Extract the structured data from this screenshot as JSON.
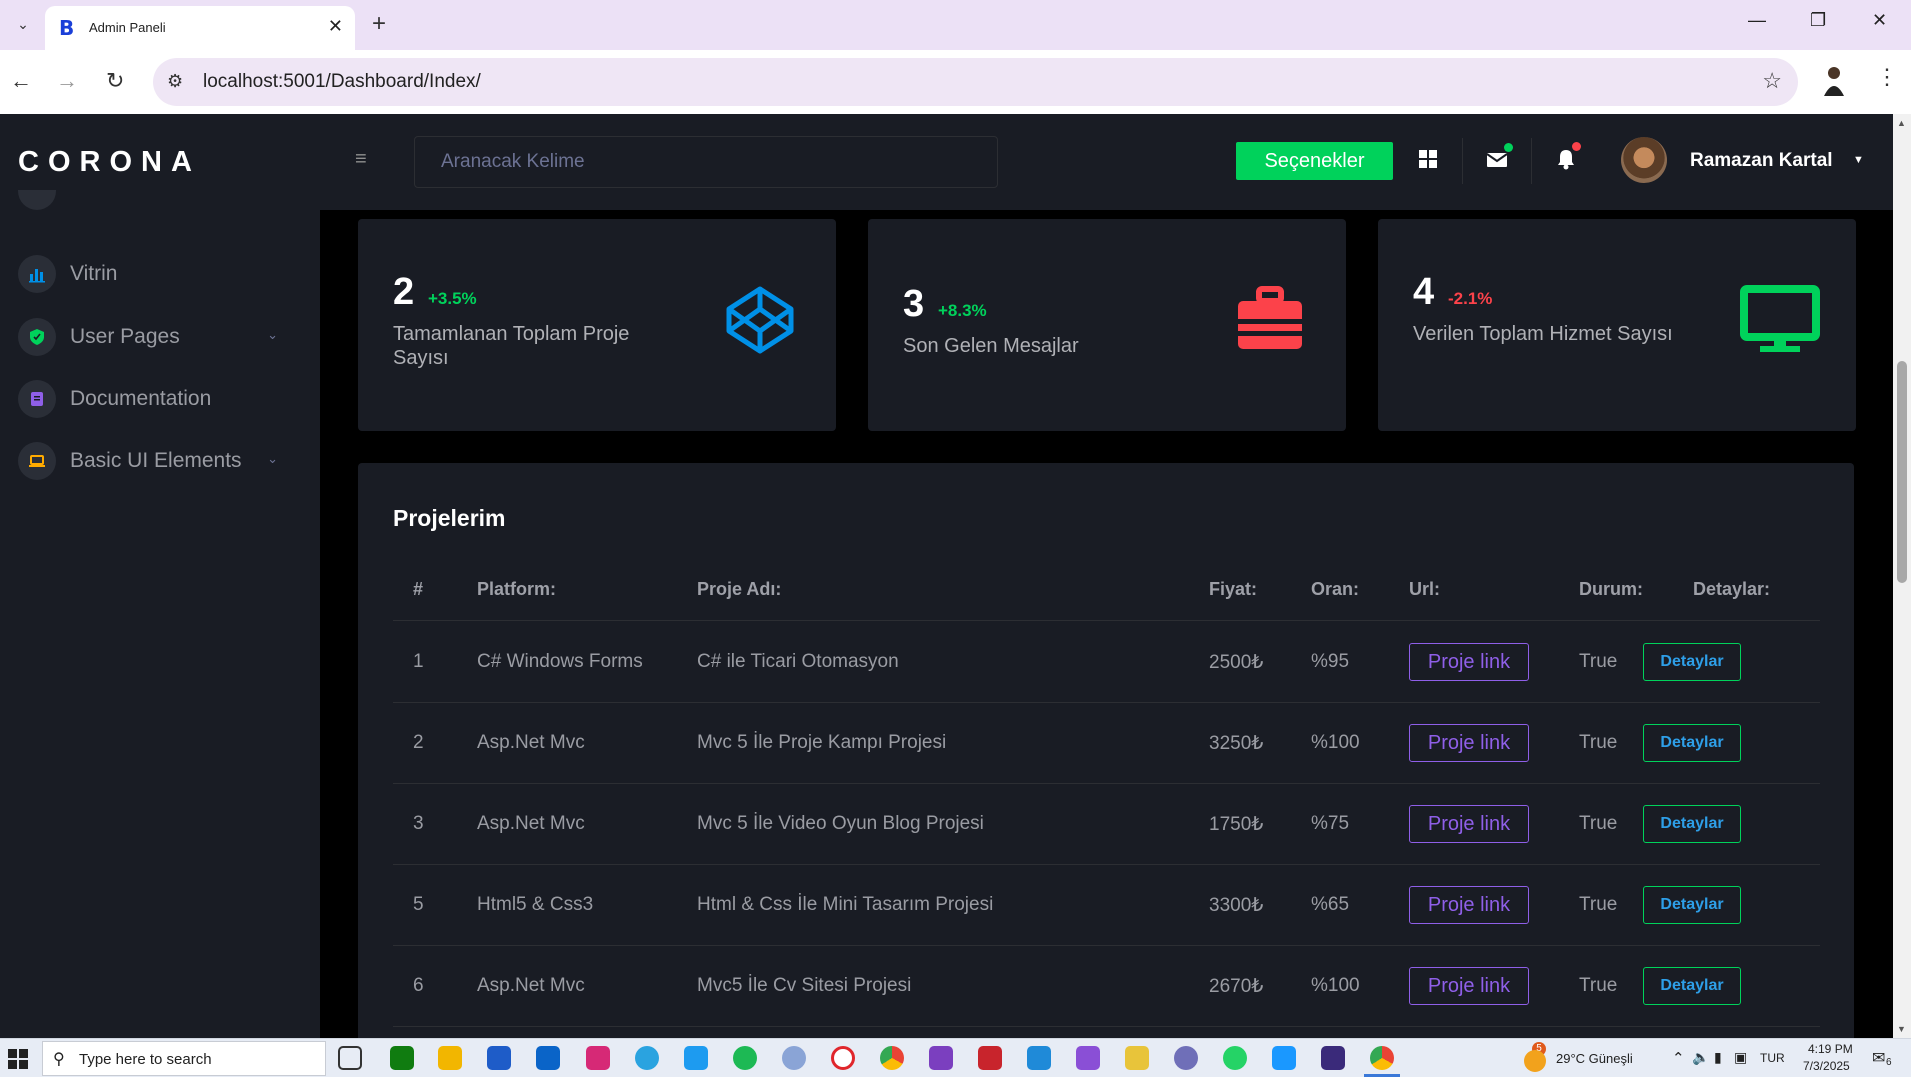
{
  "browser": {
    "tab_title": "Admin Paneli",
    "url": "localhost:5001/Dashboard/Index/"
  },
  "brand": "CORONA",
  "sidebar": {
    "items": [
      {
        "label": "Vitrin",
        "icon": "bar-chart-icon",
        "color": "#0090e7",
        "has_chevron": false
      },
      {
        "label": "User Pages",
        "icon": "shield-icon",
        "color": "#00d25b",
        "has_chevron": true
      },
      {
        "label": "Documentation",
        "icon": "document-icon",
        "color": "#8f5fe8",
        "has_chevron": false
      },
      {
        "label": "Basic UI Elements",
        "icon": "laptop-icon",
        "color": "#ffab00",
        "has_chevron": true
      }
    ]
  },
  "topnav": {
    "search_placeholder": "Aranacak Kelime",
    "options_button": "Seçenekler",
    "user_name": "Ramazan Kartal"
  },
  "stats": [
    {
      "value": "2",
      "change": "+3.5%",
      "change_color": "#00d25b",
      "label": "Tamamlanan Toplam Proje Sayısı",
      "icon": "codepen-icon",
      "icon_color": "#0090e7"
    },
    {
      "value": "3",
      "change": "+8.3%",
      "change_color": "#00d25b",
      "label": "Son Gelen Mesajlar",
      "icon": "briefcase-icon",
      "icon_color": "#fc424a"
    },
    {
      "value": "4",
      "change": "-2.1%",
      "change_color": "#fc424a",
      "label": "Verilen Toplam Hizmet Sayısı",
      "icon": "monitor-icon",
      "icon_color": "#00d25b"
    }
  ],
  "projects": {
    "title": "Projelerim",
    "columns": [
      "#",
      "Platform:",
      "Proje Adı:",
      "Fiyat:",
      "Oran:",
      "Url:",
      "Durum:",
      "Detaylar:"
    ],
    "link_label": "Proje link",
    "detail_label": "Detaylar",
    "rows": [
      {
        "id": "1",
        "platform": "C# Windows Forms",
        "name": "C# ile Ticari Otomasyon",
        "price": "2500₺",
        "rate": "%95",
        "status": "True"
      },
      {
        "id": "2",
        "platform": "Asp.Net Mvc",
        "name": "Mvc 5 İle Proje Kampı Projesi",
        "price": "3250₺",
        "rate": "%100",
        "status": "True"
      },
      {
        "id": "3",
        "platform": "Asp.Net Mvc",
        "name": "Mvc 5 İle Video Oyun Blog Projesi",
        "price": "1750₺",
        "rate": "%75",
        "status": "True"
      },
      {
        "id": "5",
        "platform": "Html5 & Css3",
        "name": "Html & Css İle Mini Tasarım Projesi",
        "price": "3300₺",
        "rate": "%65",
        "status": "True"
      },
      {
        "id": "6",
        "platform": "Asp.Net Mvc",
        "name": "Mvc5 İle Cv Sitesi Projesi",
        "price": "2670₺",
        "rate": "%100",
        "status": "True"
      }
    ]
  },
  "taskbar": {
    "search_placeholder": "Type here to search",
    "weather": "29°C  Güneşli",
    "language": "TUR",
    "time": "4:19 PM",
    "date": "7/3/2025",
    "notification_count": "6",
    "weather_badge": "5"
  }
}
